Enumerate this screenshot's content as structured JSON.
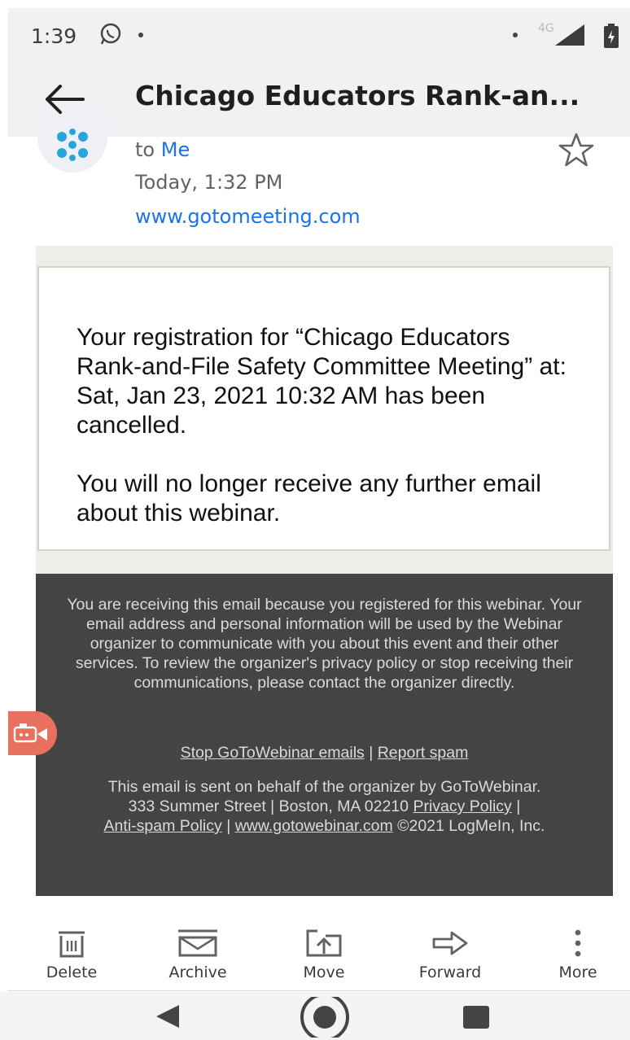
{
  "status_bar": {
    "time": "1:39",
    "network": "4G"
  },
  "app_bar": {
    "subject": "Chicago Educators Rank-an..."
  },
  "sender": {
    "to_prefix": "to",
    "recipient": "Me",
    "date": "Today, 1:32 PM",
    "link": "www.gotomeeting.com"
  },
  "message": {
    "paragraph_1": "Your registration for “Chicago Educators Rank-and-File Safety Committee Meeting” at: Sat, Jan 23, 2021 10:32 AM has been cancelled.",
    "paragraph_2": "You will no longer receive any further email about this webinar."
  },
  "footer": {
    "notice": "You are receiving this email because you registered for this webinar. Your email address and personal information will be used by the Webinar organizer to communicate with you about this event and their other services. To review the organizer's privacy policy or stop receiving their communications, please contact the organizer directly.",
    "stop_link": "Stop GoToWebinar emails",
    "sep": "|",
    "report_link": "Report spam",
    "sent_behalf": "This email is sent on behalf of the organizer by GoToWebinar.",
    "address": "333 Summer Street | Boston, MA 02210",
    "privacy_link": "Privacy Policy",
    "antispam_link": "Anti-spam Policy",
    "site_link": "www.gotowebinar.com",
    "copyright": "©2021 LogMeIn, Inc."
  },
  "actions": [
    {
      "label": "Delete",
      "icon": "trash-icon"
    },
    {
      "label": "Archive",
      "icon": "archive-icon"
    },
    {
      "label": "Move",
      "icon": "move-icon"
    },
    {
      "label": "Forward",
      "icon": "forward-icon"
    },
    {
      "label": "More",
      "icon": "more-vertical-icon"
    }
  ],
  "colors": {
    "accent": "#1a73e8",
    "footer_bg": "#444444",
    "frame_bg": "#eeede8",
    "fab": "#e8705e"
  }
}
